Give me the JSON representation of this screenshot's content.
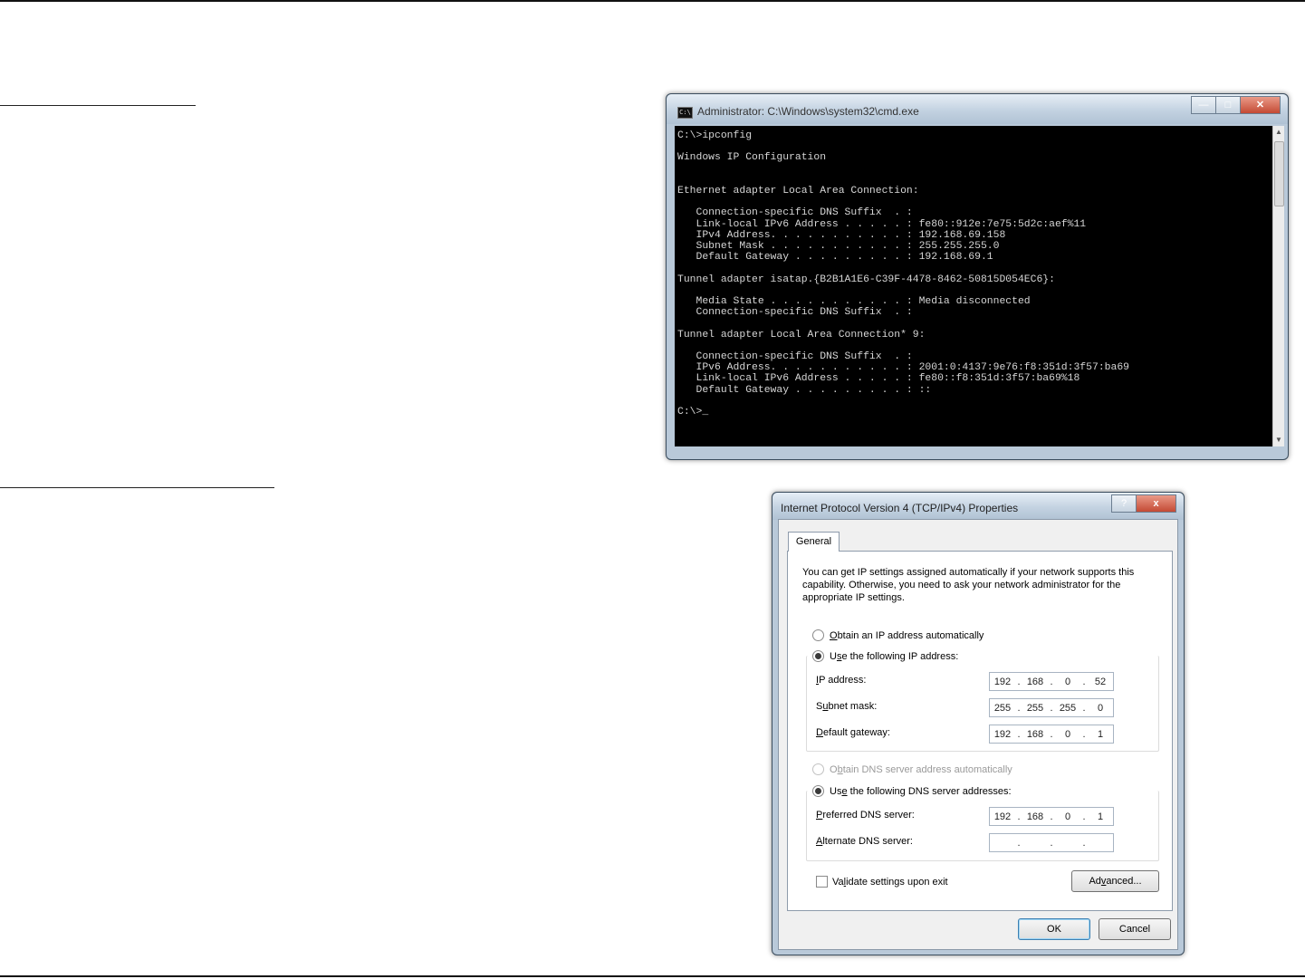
{
  "cmd": {
    "title": "Administrator: C:\\Windows\\system32\\cmd.exe",
    "icon": "cmd-app-icon",
    "output": "C:\\>ipconfig\n\nWindows IP Configuration\n\n\nEthernet adapter Local Area Connection:\n\n   Connection-specific DNS Suffix  . :\n   Link-local IPv6 Address . . . . . : fe80::912e:7e75:5d2c:aef%11\n   IPv4 Address. . . . . . . . . . . : 192.168.69.158\n   Subnet Mask . . . . . . . . . . . : 255.255.255.0\n   Default Gateway . . . . . . . . . : 192.168.69.1\n\nTunnel adapter isatap.{B2B1A1E6-C39F-4478-8462-50815D054EC6}:\n\n   Media State . . . . . . . . . . . : Media disconnected\n   Connection-specific DNS Suffix  . :\n\nTunnel adapter Local Area Connection* 9:\n\n   Connection-specific DNS Suffix  . :\n   IPv6 Address. . . . . . . . . . . : 2001:0:4137:9e76:f8:351d:3f57:ba69\n   Link-local IPv6 Address . . . . . : fe80::f8:351d:3f57:ba69%18\n   Default Gateway . . . . . . . . . : ::\n\nC:\\>_"
  },
  "dialog": {
    "title": "Internet Protocol Version 4 (TCP/IPv4) Properties",
    "help_glyph": "?",
    "close_glyph": "x",
    "tab_general": "General",
    "intro": "You can get IP settings assigned automatically if your network supports this capability. Otherwise, you need to ask your network administrator for the appropriate IP settings.",
    "obtain_ip_auto": {
      "pre": "",
      "key": "O",
      "post": "btain an IP address automatically",
      "selected": false
    },
    "use_following_ip": {
      "pre": "U",
      "key": "s",
      "post": "e the following IP address:",
      "selected": true
    },
    "ip_address": {
      "pre": "",
      "key": "I",
      "post": "P address:",
      "value": [
        "192",
        "168",
        "0",
        "52"
      ]
    },
    "subnet_mask": {
      "pre": "S",
      "key": "u",
      "post": "bnet mask:",
      "value": [
        "255",
        "255",
        "255",
        "0"
      ]
    },
    "default_gateway": {
      "pre": "",
      "key": "D",
      "post": "efault gateway:",
      "value": [
        "192",
        "168",
        "0",
        "1"
      ]
    },
    "obtain_dns_auto": {
      "pre": "O",
      "key": "b",
      "post": "tain DNS server address automatically",
      "selected": false,
      "disabled": true
    },
    "use_following_dns": {
      "pre": "Us",
      "key": "e",
      "post": " the following DNS server addresses:",
      "selected": true
    },
    "preferred_dns": {
      "pre": "",
      "key": "P",
      "post": "referred DNS server:",
      "value": [
        "192",
        "168",
        "0",
        "1"
      ]
    },
    "alternate_dns": {
      "pre": "",
      "key": "A",
      "post": "lternate DNS server:",
      "value": [
        "",
        "",
        "",
        ""
      ]
    },
    "validate": {
      "pre": "Va",
      "key": "l",
      "post": "idate settings upon exit",
      "checked": false
    },
    "advanced": {
      "pre": "Ad",
      "key": "v",
      "post": "anced..."
    },
    "ok_label": "OK",
    "cancel_label": "Cancel"
  }
}
